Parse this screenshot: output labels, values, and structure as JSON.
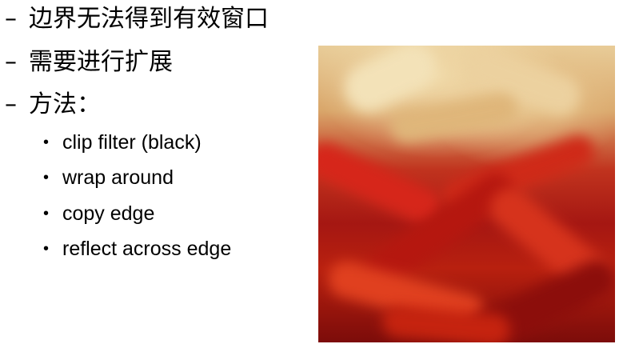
{
  "dash_items": [
    {
      "text": "边界无法得到有效窗口"
    },
    {
      "text": "需要进行扩展"
    },
    {
      "text": "方法："
    }
  ],
  "dash_symbol": "–",
  "bullet_symbol": "•",
  "bullet_items": [
    {
      "text": "clip filter (black)"
    },
    {
      "text": "wrap around"
    },
    {
      "text": "copy edge"
    },
    {
      "text": "reflect across edge"
    }
  ],
  "image": {
    "subject": "blurred dried red chili peppers",
    "colors": {
      "top": "#e8cc98",
      "middle": "#c0331e",
      "bottom": "#7c0c0a"
    }
  }
}
